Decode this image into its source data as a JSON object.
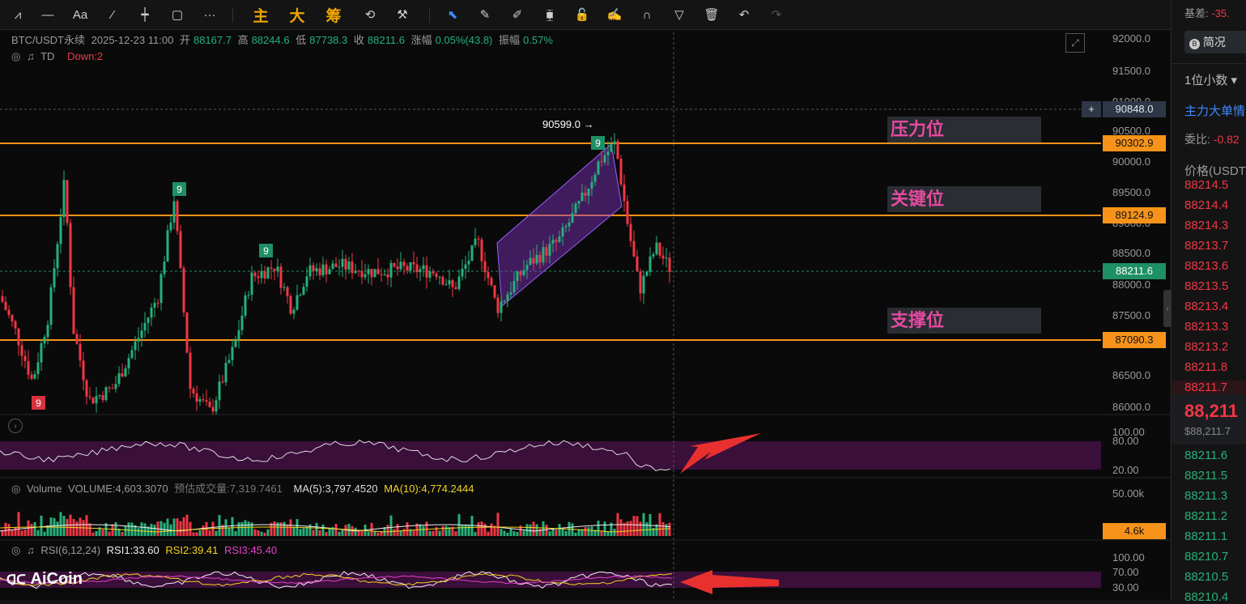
{
  "toolbar": {
    "items": [
      {
        "name": "trend-line-icon",
        "glyph": "⩘"
      },
      {
        "name": "horizontal-line-icon",
        "glyph": "—"
      },
      {
        "name": "text-tool-icon",
        "glyph": "Aa"
      },
      {
        "name": "brush-icon",
        "glyph": "⁄"
      },
      {
        "name": "crosshair-icon",
        "glyph": "┿"
      },
      {
        "name": "rectangle-icon",
        "glyph": "▢"
      },
      {
        "name": "more-icon",
        "glyph": "···"
      }
    ],
    "cn_buttons": [
      "主",
      "大",
      "筹"
    ],
    "right_items": [
      {
        "name": "screenshot-icon",
        "glyph": "⟲"
      },
      {
        "name": "tools-icon",
        "glyph": "⚒"
      },
      {
        "name": "select-cursor-icon",
        "glyph": "⬉"
      },
      {
        "name": "ruler-icon",
        "glyph": "✎"
      },
      {
        "name": "pen-icon",
        "glyph": "✐"
      },
      {
        "name": "candles-icon",
        "glyph": "⧯"
      },
      {
        "name": "lock-icon",
        "glyph": "🔓"
      },
      {
        "name": "edit-icon",
        "glyph": "✍"
      },
      {
        "name": "magnet-icon",
        "glyph": "∩"
      },
      {
        "name": "filter-icon",
        "glyph": "▽"
      },
      {
        "name": "trash-icon",
        "glyph": "🗑"
      },
      {
        "name": "undo-icon",
        "glyph": "↶"
      },
      {
        "name": "redo-icon",
        "glyph": "↷"
      }
    ]
  },
  "header": {
    "symbol": "BTC/USDT永续",
    "datetime": "2025-12-23 11:00",
    "open_label": "开",
    "open": "88167.7",
    "high_label": "高",
    "high": "88244.6",
    "low_label": "低",
    "low": "87738.3",
    "close_label": "收",
    "close": "88211.6",
    "change_label": "涨幅",
    "change": "0.05%(43.8)",
    "amp_label": "振幅",
    "amp": "0.57%"
  },
  "td": {
    "label": "TD",
    "down": "Down:2"
  },
  "price_axis": [
    "92000.0",
    "91500.0",
    "91000.0",
    "90500.0",
    "90000.0",
    "89500.0",
    "89000.0",
    "88500.0",
    "88000.0",
    "87500.0",
    "86500.0",
    "86000.0"
  ],
  "price_tags": {
    "crosshair": "90848.0",
    "resistance": "90302.9",
    "key": "89124.9",
    "last": "88211.6",
    "support": "87090.3"
  },
  "annotations": {
    "resistance": "压力位",
    "key": "关键位",
    "support": "支撑位",
    "high_marker": "90599.0"
  },
  "td_counts": [
    "9",
    "9",
    "9",
    "9"
  ],
  "osc_axis": [
    "100.00",
    "80.00",
    "20.00"
  ],
  "volume": {
    "label": "Volume",
    "value": "VOLUME:4,603.3070",
    "forecast": "预估成交量:7,319.7461",
    "ma5": "MA(5):3,797.4520",
    "ma10": "MA(10):4,774.2444",
    "axis_top": "50.00k",
    "tag": "4.6k"
  },
  "rsi": {
    "label": "RSI(6,12,24)",
    "rsi1": "RSI1:33.60",
    "rsi2": "RSI2:39.41",
    "rsi3": "RSI3:45.40",
    "axis": [
      "100.00",
      "70.00",
      "30.00"
    ]
  },
  "logo": "AiCoin",
  "right_panel": {
    "basis_label": "基差:",
    "basis_value": "-35.",
    "brief": "简况",
    "decimals": "1位小数",
    "main_force": "主力大单情",
    "ratio_label": "委比:",
    "ratio_value": "-0.82",
    "price_header": "价格(USDT",
    "asks": [
      "88214.5",
      "88214.4",
      "88214.3",
      "88213.7",
      "88213.6",
      "88213.5",
      "88213.4",
      "88213.3",
      "88213.2",
      "88211.8",
      "88211.7"
    ],
    "mid_price": "88,211",
    "mid_sub": "$88,211.7",
    "bids": [
      "88211.6",
      "88211.5",
      "88211.3",
      "88211.2",
      "88211.1",
      "88210.7",
      "88210.5",
      "88210.4"
    ]
  },
  "colors": {
    "up": "#26b07a",
    "down": "#f23645",
    "level": "#f7931a",
    "accent": "#f0a500",
    "annot": "#e54aa0"
  }
}
